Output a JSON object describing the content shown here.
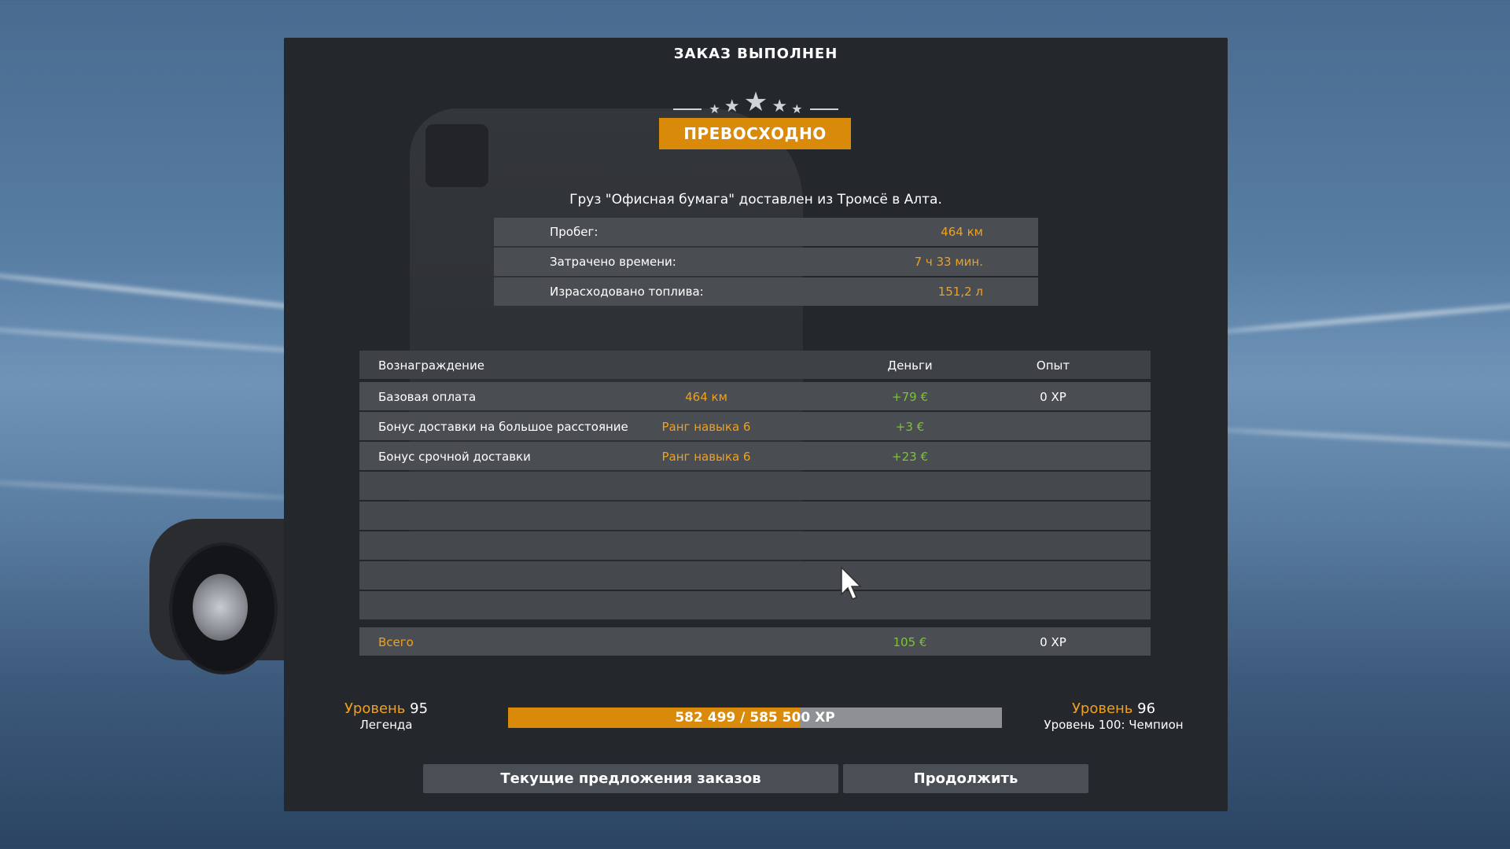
{
  "dialog": {
    "title": "ЗАКАЗ ВЫПОЛНЕН",
    "rating": "ПРЕВОСХОДНО",
    "cargo_summary": "Груз \"Офисная бумага\" доставлен из Тромсё в Алта."
  },
  "stats": [
    {
      "label": "Пробег:",
      "value": "464 км"
    },
    {
      "label": "Затрачено времени:",
      "value": "7 ч 33 мин."
    },
    {
      "label": "Израсходовано топлива:",
      "value": "151,2 л"
    }
  ],
  "rewards": {
    "headers": {
      "reward": "Вознаграждение",
      "money": "Деньги",
      "xp": "Опыт"
    },
    "rows": [
      {
        "name": "Базовая оплата",
        "detail": "464 км",
        "money": "+79 €",
        "xp": "0 XP"
      },
      {
        "name": "Бонус доставки на большое расстояние",
        "detail": "Ранг навыка 6",
        "money": "+3 €",
        "xp": ""
      },
      {
        "name": "Бонус срочной доставки",
        "detail": "Ранг навыка 6",
        "money": "+23 €",
        "xp": ""
      }
    ],
    "total": {
      "label": "Всего",
      "money": "105 €",
      "xp": "0 XP"
    }
  },
  "level": {
    "word": "Уровень",
    "current": {
      "number": "95",
      "title": "Легенда"
    },
    "next": {
      "number": "96",
      "subtitle": "Уровень 100: Чемпион"
    },
    "xp_text": "582 499 / 585 500 XP",
    "progress_fraction": 0.59
  },
  "buttons": {
    "offers": "Текущие предложения заказов",
    "continue": "Продолжить"
  },
  "colors": {
    "accent": "#d98a0b",
    "value_orange": "#f0a11c",
    "money_green": "#7cc432"
  }
}
